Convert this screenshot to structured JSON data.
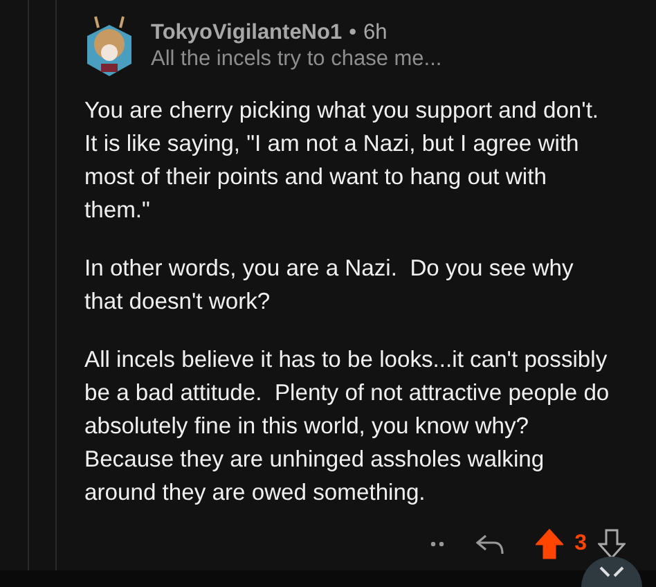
{
  "comment": {
    "author": "TokyoVigilanteNo1",
    "separator": "•",
    "age": "6h",
    "flair": "All the incels try to chase me...",
    "paragraphs": [
      "You are cherry picking what you support and don't.  It is like saying, \"I am not a Nazi, but I agree with most of their points and want to hang out with them.\"",
      "In other words, you are a Nazi.  Do you see why that doesn't work?",
      "All incels believe it has to be looks...it can't possibly be a bad attitude.  Plenty of not attractive people do absolutely fine in this world, you know why?  Because they are unhinged assholes walking around they are owed something."
    ],
    "upvoted": true,
    "downvoted": false,
    "score": "3"
  }
}
